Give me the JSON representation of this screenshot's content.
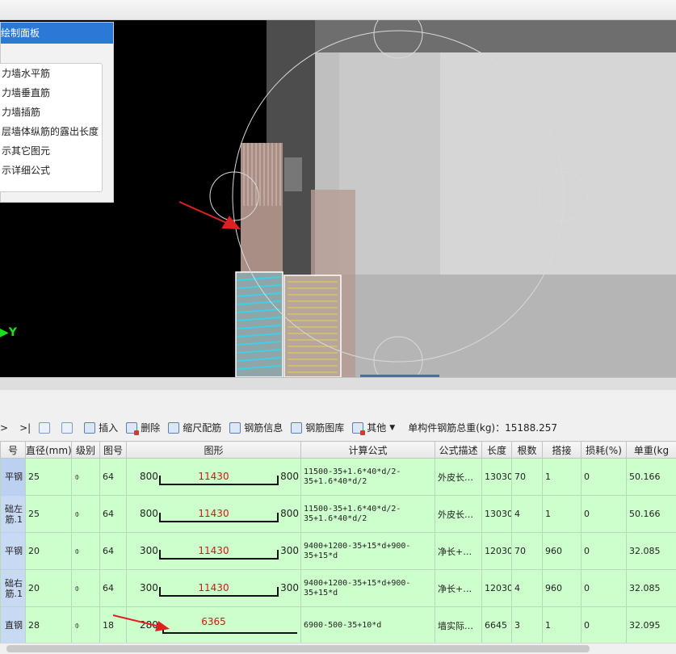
{
  "control_panel": {
    "title": "绘制面板",
    "items": [
      {
        "label": "力墙水平筋"
      },
      {
        "label": "力墙垂直筋"
      },
      {
        "label": "力墙插筋"
      },
      {
        "label": "层墙体纵筋的露出长度"
      },
      {
        "label": "示其它图元"
      },
      {
        "label": "示详细公式"
      }
    ]
  },
  "viewport": {
    "axis_label": "Y"
  },
  "toolbar": {
    "nav_prev": ">",
    "nav_last": ">|",
    "insert": "插入",
    "delete": "删除",
    "scale_rebar": "缩尺配筋",
    "rebar_info": "钢筋信息",
    "rebar_library": "钢筋图库",
    "other": "其他",
    "total_weight_label": "单构件钢筋总重(kg)：15188.257"
  },
  "table": {
    "headers": [
      "号",
      "直径(mm)",
      "级别",
      "图号",
      "图形",
      "计算公式",
      "公式描述",
      "长度",
      "根数",
      "搭接",
      "损耗(%)",
      "单重(kg"
    ],
    "rows": [
      {
        "name": "平钢",
        "diameter": "25",
        "grade": "⌽",
        "fig_no": "64",
        "left": "800",
        "mid": "11430",
        "right": "800",
        "formula": "11500-35+1.6*40*d/2-35+1.6*40*d/2",
        "desc": "外皮长…",
        "length": "13030",
        "count": "70",
        "lap": "1",
        "loss": "0",
        "unit_weight": "50.166"
      },
      {
        "name": "础左筋.1",
        "diameter": "25",
        "grade": "⌽",
        "fig_no": "64",
        "left": "800",
        "mid": "11430",
        "right": "800",
        "formula": "11500-35+1.6*40*d/2-35+1.6*40*d/2",
        "desc": "外皮长…",
        "length": "13030",
        "count": "4",
        "lap": "1",
        "loss": "0",
        "unit_weight": "50.166"
      },
      {
        "name": "平钢",
        "diameter": "20",
        "grade": "⌽",
        "fig_no": "64",
        "left": "300",
        "mid": "11430",
        "right": "300",
        "formula": "9400+1200-35+15*d+900-35+15*d",
        "desc": "净长+…",
        "length": "12030",
        "count": "70",
        "lap": "960",
        "loss": "0",
        "unit_weight": "32.085"
      },
      {
        "name": "础右筋.1",
        "diameter": "20",
        "grade": "⌽",
        "fig_no": "64",
        "left": "300",
        "mid": "11430",
        "right": "300",
        "formula": "9400+1200-35+15*d+900-35+15*d",
        "desc": "净长+…",
        "length": "12030",
        "count": "4",
        "lap": "960",
        "loss": "0",
        "unit_weight": "32.085"
      },
      {
        "name": "直钢",
        "diameter": "28",
        "grade": "⌽",
        "fig_no": "18",
        "left": "280",
        "mid": "6365",
        "right": "",
        "formula": "6900-500-35+10*d",
        "desc": "墙实际…",
        "length": "6645",
        "count": "3",
        "lap": "1",
        "loss": "0",
        "unit_weight": "32.095"
      }
    ]
  }
}
